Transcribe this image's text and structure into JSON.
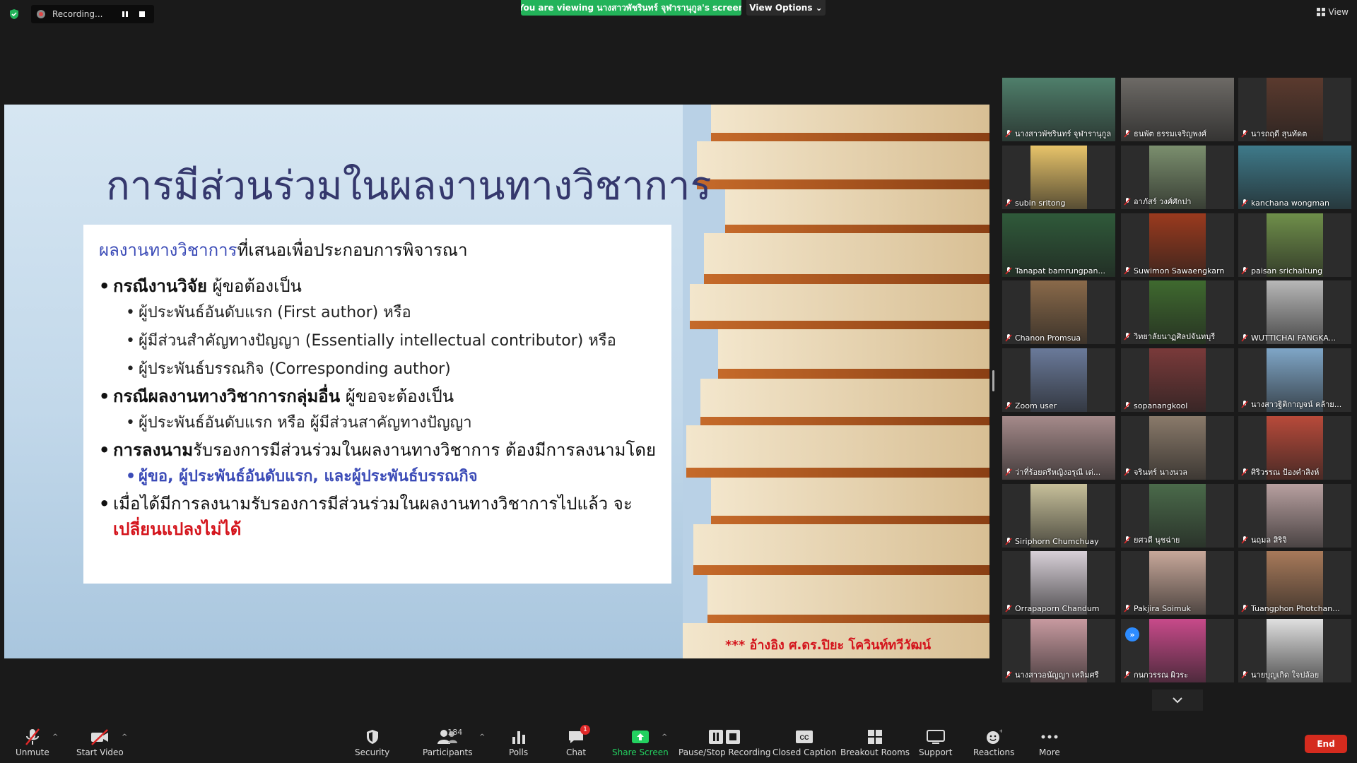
{
  "topbar": {
    "recording_label": "Recording...",
    "viewing_banner": "You are viewing นางสาวพัชรินทร์ จุฬารานุกูล's screen",
    "view_options": "View Options ⌄",
    "view_label": "View"
  },
  "slide": {
    "title": "การมีส่วนร่วมในผลงานทางวิชาการ",
    "intro_highlight": "ผลงานทางวิชาการ",
    "intro_rest": "ที่เสนอเพื่อประกอบการพิจารณา",
    "b1_bold": "กรณีงานวิจัย",
    "b1_rest": " ผู้ขอต้องเป็น",
    "b1_s1": "ผู้ประพันธ์อันดับแรก (First author)  หรือ",
    "b1_s2": "ผู้มีส่วนสำคัญทางปัญญา (Essentially intellectual contributor)  หรือ",
    "b1_s3": "ผู้ประพันธ์บรรณกิจ (Corresponding author)",
    "b2_bold": "กรณีผลงานทางวิชาการกลุ่มอื่น",
    "b2_rest": " ผู้ขอจะต้องเป็น",
    "b2_s1": "ผู้ประพันธ์อันดับแรก หรือ ผู้มีส่วนสาคัญทางปัญญา",
    "b3_bold": "การลงนาม",
    "b3_rest": "รับรองการมีส่วนร่วมในผลงานทางวิชาการ ต้องมีการลงนามโดย",
    "b3_s1": "ผู้ขอ, ผู้ประพันธ์อันดับแรก, และผู้ประพันธ์บรรณกิจ",
    "b4_rest": "เมื่อได้มีการลงนามรับรองการมีส่วนร่วมในผลงานทางวิชาการไปแล้ว จะ",
    "b4_red": "เปลี่ยนแปลงไม่ได้",
    "reference": "*** อ้างอิง ศ.ดร.ปิยะ โควินท์ทวีวัฒน์"
  },
  "participants": [
    "นางสาวพัชรินทร์ จุฬารานุกูล",
    "ธนพัต ธรรมเจริญพงศ์",
    "นารถฤดี สุนทัดต",
    "subin sritong",
    "อาภัสร์ วงศ์ศักปา",
    "kanchana wongman",
    "Tanapat bamrungpan...",
    "Suwimon Sawaengkarn",
    "paisan srichaitung",
    "Chanon Promsua",
    "วิทยาลัยนาฏศิลปจันทบุรี",
    "WUTTICHAI FANGKA...",
    "Zoom user",
    "sopanangkool",
    "นางสาวฐิติกาญจน์ คล้าย...",
    "ว่าที่ร้อยตรีหญิงอรุณี เต่...",
    "จรินทร์ นางนวล",
    "ศิริวรรณ ป้องคำสิงห์",
    "Siriphorn Chumchuay",
    "ยศวดี นุชฉ่าย",
    "นฤมล สิริจิ",
    "Orrapaporn Chandum",
    "Pakjira Soimuk",
    "Tuangphon Photchan...",
    "นางสาวอนัญญา เหลิมศรี",
    "กนกวรรณ ผิวระ",
    "นายบุญเกิด ใจปล้อย"
  ],
  "toolbar": {
    "unmute": "Unmute",
    "start_video": "Start Video",
    "security": "Security",
    "participants": "Participants",
    "participant_count": "184",
    "polls": "Polls",
    "chat": "Chat",
    "chat_badge": "1",
    "share_screen": "Share Screen",
    "pause_recording": "Pause/Stop Recording",
    "closed_caption": "Closed Caption",
    "breakout_rooms": "Breakout Rooms",
    "support": "Support",
    "reactions": "Reactions",
    "more": "More",
    "end": "End"
  },
  "colors": {
    "share_green": "#23d160",
    "banner_green": "#23b35a",
    "end_red": "#d52b1e",
    "slide_blue": "#3b4bb7",
    "slide_red": "#d4141c"
  }
}
